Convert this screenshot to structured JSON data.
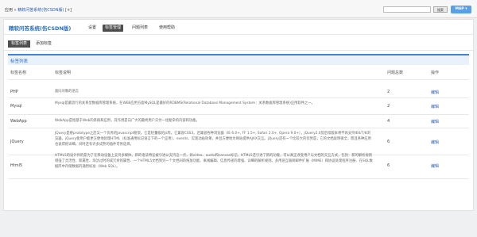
{
  "breadcrumb": {
    "prefix": "应用 » ",
    "link": "精软问答系统(伤CSDN版)",
    "suffix": " [+]"
  },
  "search": {
    "placeholder": "",
    "button": "搜索",
    "map_button": "MAP ▾"
  },
  "app": {
    "title": "精软问答系统(伤CSDN版)"
  },
  "nav": [
    "设置",
    "标签管理",
    "问题列表",
    "使用帮助"
  ],
  "subnav": [
    "标签列表",
    "添加标签"
  ],
  "list_header": "标签列表",
  "columns": [
    "标签名称",
    "标签说明",
    "问题总数",
    "操作"
  ],
  "rows": [
    {
      "name": "PHP",
      "desc": "面向对象的语言",
      "count": "2",
      "action": "编辑"
    },
    {
      "name": "Mysql",
      "desc": "Mysql是最流行的关系型数据库管理系统，在WEB应用方面MySQL是最好的RDBMS(Relational Database Management System：关系数据库管理系统)应用软件之一。",
      "count": "2",
      "action": "编辑"
    },
    {
      "name": "WebApp",
      "desc": "WebApp是指基于Web的系统和应用，其作用是向广大的最终用户交付一组复杂的内容和功能。",
      "count": "4",
      "action": "编辑"
    },
    {
      "name": "JQuery",
      "desc": "JQuery是继prototype之后又一个优秀的Javascript框架。它是轻量级的js库，它兼容CSS3，还兼容各种浏览器（IE 6.0+, FF 1.5+, Safari 2.0+, Opera 9.0+），jQuery2.0及后续版本将不再支持IE6/7/8浏览器。jQuery使用户能更方便地处理HTML（标准通用标记语言下的一个应用）、events、实现动画效果，并且方便地为网站提供AJAX交互。jQuery还有一个比较大的优势是，它的文档说明很全，而且各种应用也说得很详细，同时还有许多成熟的插件可供选择。",
      "count": "6",
      "action": "编辑"
    },
    {
      "name": "Html5",
      "desc": "HTML5的设计目的是为了在移动设备上支持多媒体。新的语法特征被引进以支持这一点，如video、audio和canvas标记。HTML5还引进了新的功能，可以真正改变用户与文档的交互方式，包括：新的解析规则增强了灵活性、新属性、淘汰过时的或冗余的属性、一个HTML5文档到另一个文档间的拖放功能、离线编辑、信息传递的增强、详细的解析规则、多用途互联网邮件扩展（MIME）和协议处理程序注册、在SQL数据库中存储数据的通用标准（Web SQL）。",
      "count": "6",
      "action": "编辑"
    }
  ]
}
